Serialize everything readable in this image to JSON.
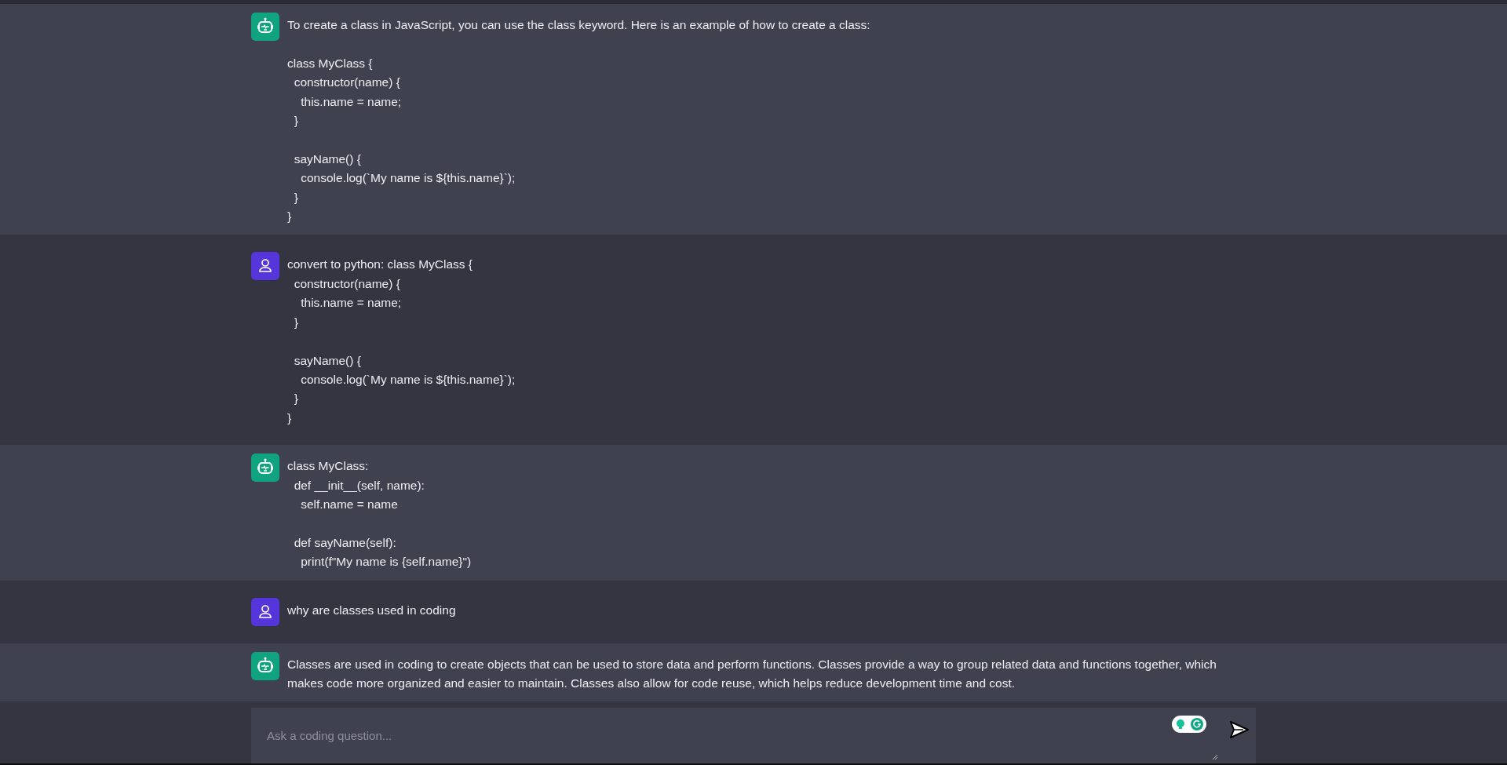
{
  "messages": [
    {
      "kind": "bot",
      "text": "To create a class in JavaScript, you can use the class keyword. Here is an example of how to create a class:\n\nclass MyClass {\n  constructor(name) {\n    this.name = name;\n  }\n\n  sayName() {\n    console.log(`My name is ${this.name}`);\n  }\n}"
    },
    {
      "kind": "user",
      "text": "convert to python: class MyClass {\n  constructor(name) {\n    this.name = name;\n  }\n\n  sayName() {\n    console.log(`My name is ${this.name}`);\n  }\n}"
    },
    {
      "kind": "bot",
      "text": "class MyClass:\n  def __init__(self, name):\n    self.name = name\n\n  def sayName(self):\n    print(f\"My name is {self.name}\")"
    },
    {
      "kind": "user",
      "text": "why are classes used in coding"
    },
    {
      "kind": "bot",
      "text": "Classes are used in coding to create objects that can be used to store data and perform functions. Classes provide a way to group related data and functions together, which makes code more organized and easier to maintain. Classes also allow for code reuse, which helps reduce development time and cost."
    }
  ],
  "input": {
    "placeholder": "Ask a coding question..."
  }
}
